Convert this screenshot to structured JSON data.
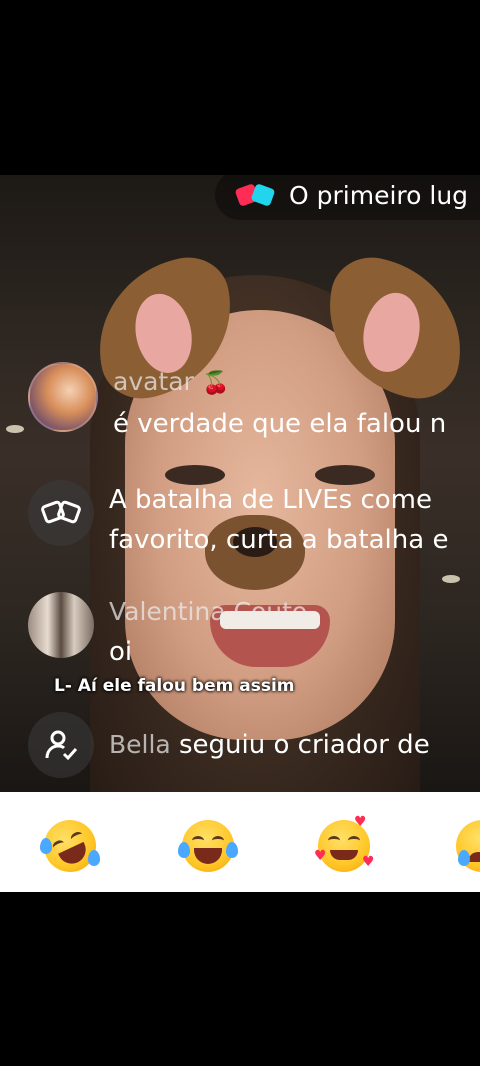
{
  "banner": {
    "text": "O primeiro lug",
    "icon": "live-battle-icon"
  },
  "chat": [
    {
      "username": "avatar",
      "badge": "🍒",
      "message": "é verdade que ela falou n",
      "avatar": "user-avatar"
    },
    {
      "username": "",
      "message_line1": "A batalha de LIVEs come",
      "message_line2": "favorito, curta a batalha e",
      "avatar": "live-battle-icon"
    },
    {
      "username": "Valentina Couto",
      "message": "oi",
      "avatar": "user-avatar"
    },
    {
      "username": "Bella",
      "message": "seguiu o criador de",
      "avatar": "follow-user-icon"
    }
  ],
  "caption": "L- Aí ele falou bem assim",
  "reactions": [
    "rolling-laughing-emoji",
    "tears-of-joy-emoji",
    "smiling-hearts-emoji",
    "crying-emoji"
  ]
}
